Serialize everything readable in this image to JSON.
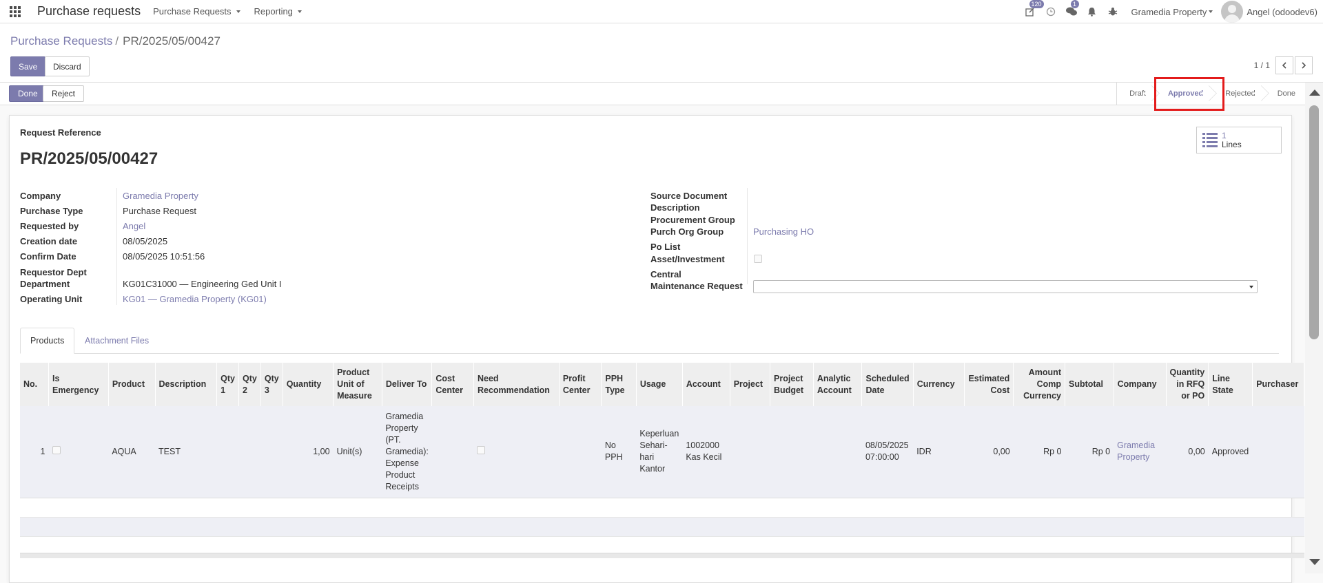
{
  "navbar": {
    "app_title": "Purchase requests",
    "menus": [
      "Purchase Requests",
      "Reporting"
    ],
    "activity_badge": "120",
    "messages_badge": "1",
    "company": "Gramedia Property",
    "user": "Angel (odoodev6)"
  },
  "breadcrumb": {
    "parent": "Purchase Requests",
    "separator": "/",
    "current": "PR/2025/05/00427"
  },
  "buttons": {
    "save": "Save",
    "discard": "Discard",
    "done": "Done",
    "reject": "Reject"
  },
  "pager": {
    "value": "1 / 1"
  },
  "stages": [
    "Draft",
    "Approved",
    "Rejected",
    "Done"
  ],
  "current_stage": "Approved",
  "smart_button": {
    "count": "1",
    "label": "Lines"
  },
  "form": {
    "ref_label": "Request Reference",
    "reference": "PR/2025/05/00427",
    "left": {
      "company_label": "Company",
      "company": "Gramedia Property",
      "purchase_type_label": "Purchase Type",
      "purchase_type": "Purchase Request",
      "requested_by_label": "Requested by",
      "requested_by": "Angel",
      "creation_date_label": "Creation date",
      "creation_date": "08/05/2025",
      "confirm_date_label": "Confirm Date",
      "confirm_date": "08/05/2025 10:51:56",
      "requestor_dept_label": "Requestor Dept",
      "department_label": "Department",
      "department": "KG01C31000 — Engineering Ged Unit I",
      "operating_unit_label": "Operating Unit",
      "operating_unit": "KG01 — Gramedia Property (KG01)"
    },
    "right": {
      "source_document_label": "Source Document",
      "description_label": "Description",
      "procurement_group_label": "Procurement Group",
      "purch_org_group_label": "Purch Org Group",
      "purch_org_group": "Purchasing HO",
      "po_list_label": "Po List",
      "asset_investment_label": "Asset/Investment",
      "central_label": "Central",
      "maintenance_request_label": "Maintenance Request"
    }
  },
  "tabs": [
    "Products",
    "Attachment Files"
  ],
  "table": {
    "headers": {
      "no": "No.",
      "is_emergency": "Is Emergency",
      "product": "Product",
      "description": "Description",
      "qty1": "Qty 1",
      "qty2": "Qty 2",
      "qty3": "Qty 3",
      "quantity": "Quantity",
      "uom": "Product Unit of Measure",
      "deliver_to": "Deliver To",
      "cost_center": "Cost Center",
      "need_recommendation": "Need Recommendation",
      "profit_center": "Profit Center",
      "pph_type": "PPH Type",
      "usage": "Usage",
      "account": "Account",
      "project": "Project",
      "project_budget": "Project Budget",
      "analytic_account": "Analytic Account",
      "scheduled_date": "Scheduled Date",
      "currency": "Currency",
      "estimated_cost": "Estimated Cost",
      "amount_comp_currency": "Amount Comp Currency",
      "subtotal": "Subtotal",
      "company": "Company",
      "qty_rfq_po": "Quantity in RFQ or PO",
      "line_state": "Line State",
      "purchaser": "Purchaser"
    },
    "rows": [
      {
        "no": "1",
        "product": "AQUA",
        "description": "TEST",
        "quantity": "1,00",
        "uom": "Unit(s)",
        "deliver_to": "Gramedia Property (PT. Gramedia): Expense Product Receipts",
        "pph_type": "No PPH",
        "usage": "Keperluan Sehari-hari Kantor",
        "account": "1002000 Kas Kecil",
        "scheduled_date": "08/05/2025 07:00:00",
        "currency": "IDR",
        "estimated_cost": "0,00",
        "amount_comp_currency": "Rp 0",
        "subtotal": "Rp 0",
        "company": "Gramedia Property",
        "qty_rfq_po": "0,00",
        "line_state": "Approved"
      }
    ]
  },
  "colors": {
    "accent": "#7c7bad",
    "highlight": "#e31b1b"
  },
  "icons": [
    "apps-grid-icon",
    "activity-icon",
    "clock-icon",
    "chat-icon",
    "bell-icon",
    "bug-icon",
    "list-icon",
    "chevron-left-icon",
    "chevron-right-icon"
  ]
}
